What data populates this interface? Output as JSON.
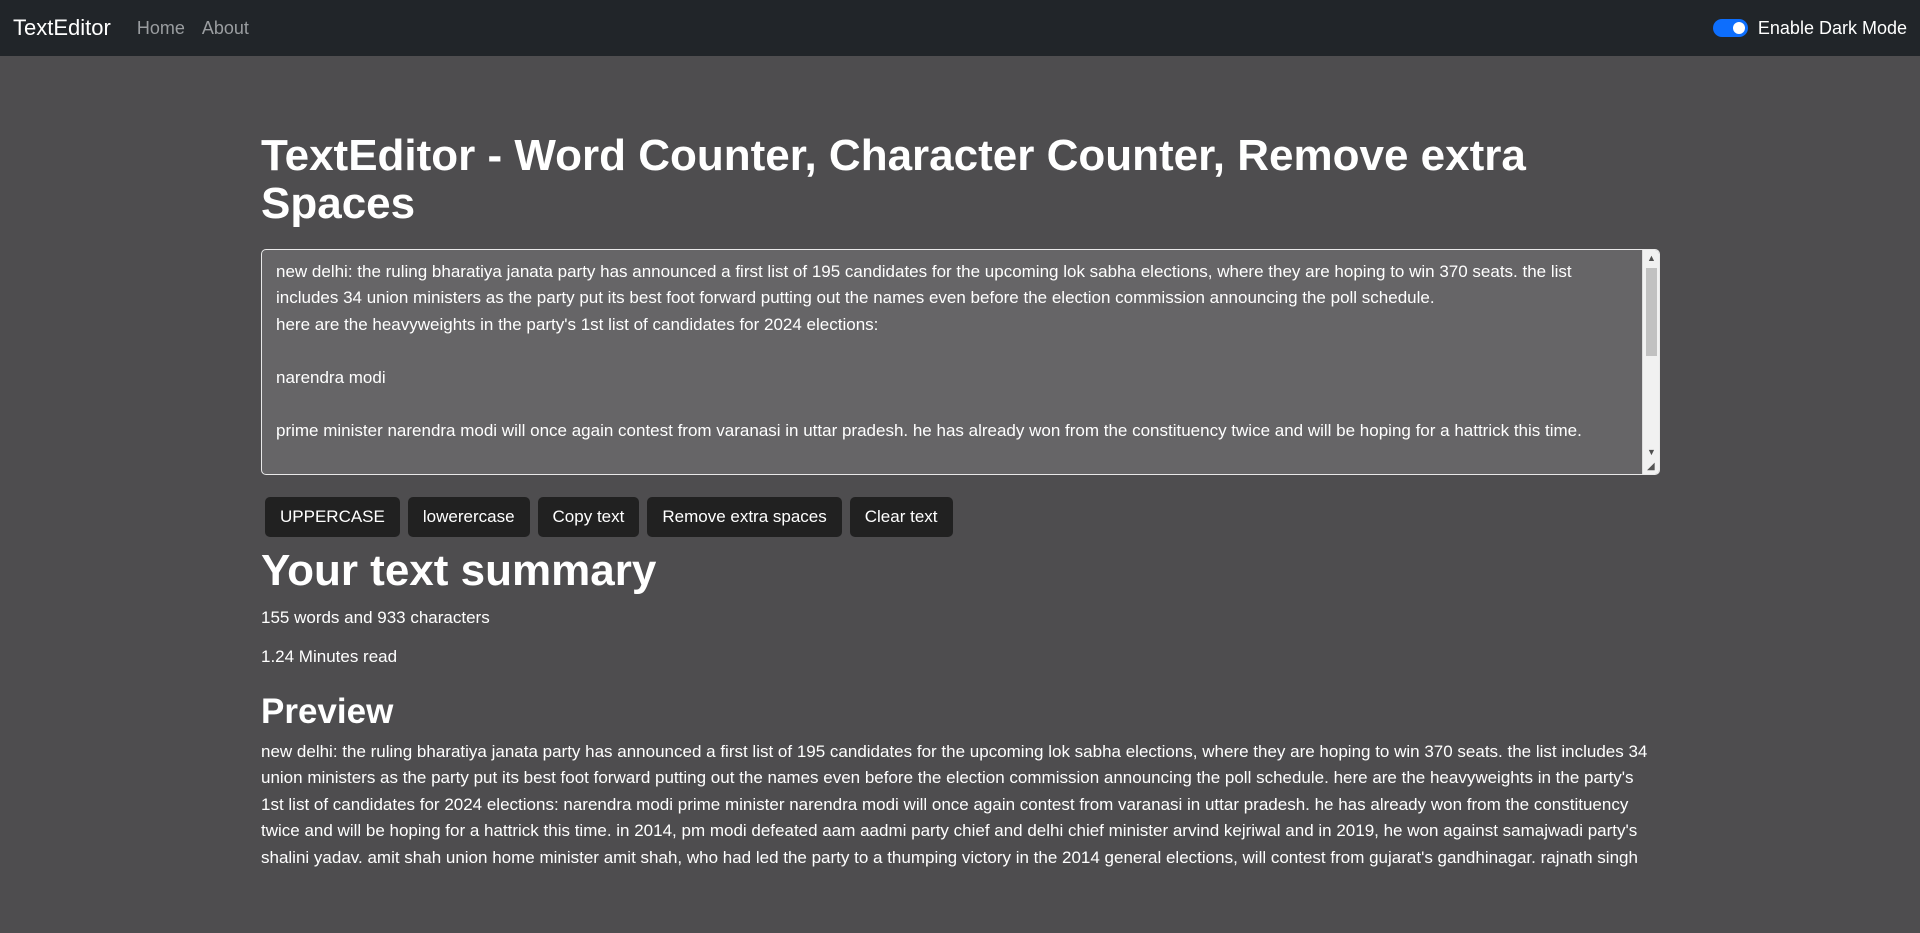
{
  "navbar": {
    "brand": "TextEditor",
    "links": [
      "Home",
      "About"
    ],
    "dark_mode_label": "Enable Dark Mode",
    "dark_mode_on": true
  },
  "main": {
    "title": "TextEditor - Word Counter, Character Counter, Remove extra Spaces",
    "editor_text": "new delhi: the ruling bharatiya janata party has announced a first list of 195 candidates for the upcoming lok sabha elections, where they are hoping to win 370 seats. the list includes 34 union ministers as the party put its best foot forward putting out the names even before the election commission announcing the poll schedule.\nhere are the heavyweights in the party's 1st list of candidates for 2024 elections:\n\nnarendra modi\n\nprime minister narendra modi will once again contest from varanasi in uttar pradesh. he has already won from the constituency twice and will be hoping for a hattrick this time.",
    "buttons": [
      "UPPERCASE",
      "lowerercase",
      "Copy text",
      "Remove extra spaces",
      "Clear text"
    ]
  },
  "summary": {
    "title": "Your text summary",
    "counts": "155 words and 933 characters",
    "read_time": "1.24 Minutes read"
  },
  "preview": {
    "title": "Preview",
    "text": "new delhi: the ruling bharatiya janata party has announced a first list of 195 candidates for the upcoming lok sabha elections, where they are hoping to win 370 seats. the list includes 34 union ministers as the party put its best foot forward putting out the names even before the election commission announcing the poll schedule. here are the heavyweights in the party's 1st list of candidates for 2024 elections: narendra modi prime minister narendra modi will once again contest from varanasi in uttar pradesh. he has already won from the constituency twice and will be hoping for a hattrick this time. in 2014, pm modi defeated aam aadmi party chief and delhi chief minister arvind kejriwal and in 2019, he won against samajwadi party's shalini yadav. amit shah union home minister amit shah, who had led the party to a thumping victory in the 2014 general elections, will contest from gujarat's gandhinagar. rajnath singh"
  },
  "colors": {
    "navbar_bg": "#212529",
    "page_bg": "#4e4d4f",
    "editor_bg": "#666567",
    "button_bg": "#212121",
    "toggle_accent": "#0d6efd"
  }
}
